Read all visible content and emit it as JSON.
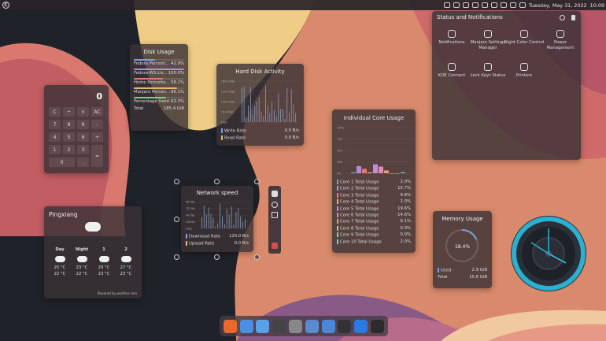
{
  "topbar": {
    "datetime": "Tuesday, May 31, 2022",
    "time": "10:09"
  },
  "calculator": {
    "display": "0",
    "buttons": [
      "C",
      "÷",
      "×",
      "AC",
      "7",
      "8",
      "9",
      "-",
      "4",
      "5",
      "6",
      "+",
      "1",
      "2",
      "3",
      "=",
      "0",
      "."
    ]
  },
  "disk_usage": {
    "title": "Disk Usage",
    "rows": [
      {
        "label": "Fedora Percent...",
        "value": "42.9%",
        "color": "#7aa2e0",
        "fill": 0.429
      },
      {
        "label": "Fedora-WS-Liv...",
        "value": "100.0%",
        "color": "#b08ed8",
        "fill": 1.0
      },
      {
        "label": "Home Percenta...",
        "value": "58.1%",
        "color": "#e07a7a",
        "fill": 0.581
      },
      {
        "label": "Manjaro Percen...",
        "value": "86.1%",
        "color": "#e8b870",
        "fill": 0.861
      },
      {
        "label": "Percentage Used",
        "value": "63.3%",
        "color": "#7ad08a",
        "fill": 0.633
      }
    ],
    "total_label": "Total",
    "total_value": "185.4 GiB"
  },
  "hdd": {
    "title": "Hard Disk Activity",
    "ticks": [
      "280.0 KiB/s",
      "210.0 KiB/s",
      "140.0 KiB/s",
      "70.0 KiB/s",
      "0 B/s"
    ],
    "write_label": "Write Rate",
    "write_value": "0.0 B/s",
    "read_label": "Read Rate",
    "read_value": "0.0 B/s"
  },
  "network": {
    "title": "Network speed",
    "ticks": [
      "982 B/s",
      "737 B/s",
      "491 B/s",
      "246 B/s",
      "0 B/s"
    ],
    "download_label": "Download Rate",
    "download_value": "120.0 B/s",
    "upload_label": "Upload Rate",
    "upload_value": "0.0 B/s"
  },
  "cores": {
    "title": "Individual Core Usage",
    "ticks": [
      "100%",
      "75%",
      "50%",
      "25%",
      "0%"
    ],
    "rows": [
      {
        "label": "Core 1 Total Usage",
        "value": "2.0%",
        "color": "#7aa2e0"
      },
      {
        "label": "Core 2 Total Usage",
        "value": "15.7%",
        "color": "#b08ed8"
      },
      {
        "label": "Core 3 Total Usage",
        "value": "9.8%",
        "color": "#e07a7a"
      },
      {
        "label": "Core 4 Total Usage",
        "value": "2.0%",
        "color": "#e8b870"
      },
      {
        "label": "Core 5 Total Usage",
        "value": "19.6%",
        "color": "#c48ae0"
      },
      {
        "label": "Core 6 Total Usage",
        "value": "14.6%",
        "color": "#e08ab0"
      },
      {
        "label": "Core 7 Total Usage",
        "value": "6.1%",
        "color": "#e0a07a"
      },
      {
        "label": "Core 8 Total Usage",
        "value": "0.0%",
        "color": "#d0c070"
      },
      {
        "label": "Core 9 Total Usage",
        "value": "0.0%",
        "color": "#8ad0a0"
      },
      {
        "label": "Core 10 Total Usage",
        "value": "2.0%",
        "color": "#7ad0c0"
      }
    ]
  },
  "weather": {
    "city": "Pingxiang",
    "days": [
      {
        "name": "Day",
        "high": "25 °C",
        "low": "22 °C"
      },
      {
        "name": "Night",
        "high": "23 °C",
        "low": "22 °C"
      },
      {
        "name": "1",
        "high": "29 °C",
        "low": "23 °C"
      },
      {
        "name": "2",
        "high": "27 °C",
        "low": "23 °C"
      }
    ],
    "credit": "Powered by weather.com"
  },
  "status": {
    "title": "Status and Notifications",
    "items": [
      {
        "label": "Notifications",
        "icon": "notifications-icon"
      },
      {
        "label": "Manjaro Settings Manager",
        "icon": "settings-manager-icon"
      },
      {
        "label": "Night Color Control",
        "icon": "night-color-icon"
      },
      {
        "label": "Power Management",
        "icon": "power-icon"
      },
      {
        "label": "KDE Connect",
        "icon": "phone-icon"
      },
      {
        "label": "Lock Keys Status",
        "icon": "keyboard-icon"
      },
      {
        "label": "Printers",
        "icon": "printer-icon"
      }
    ]
  },
  "memory": {
    "title": "Memory Usage",
    "percent": "18.4%",
    "fill": 0.184,
    "used_label": "Used",
    "used_value": "2.9 GiB",
    "total_label": "Total",
    "total_value": "15.6 GiB"
  },
  "dock": {
    "apps": [
      {
        "name": "firefox",
        "color": "#e8692a"
      },
      {
        "name": "browser",
        "color": "#4a90e2"
      },
      {
        "name": "files",
        "color": "#5aa0e8"
      },
      {
        "name": "github",
        "color": "#444"
      },
      {
        "name": "settings",
        "color": "#888"
      },
      {
        "name": "files2",
        "color": "#5a8ad0"
      },
      {
        "name": "folder",
        "color": "#4a88d8"
      },
      {
        "name": "inkscape",
        "color": "#333"
      },
      {
        "name": "appstore",
        "color": "#2a7ae2"
      },
      {
        "name": "figma",
        "color": "#2b2b2b"
      }
    ]
  }
}
